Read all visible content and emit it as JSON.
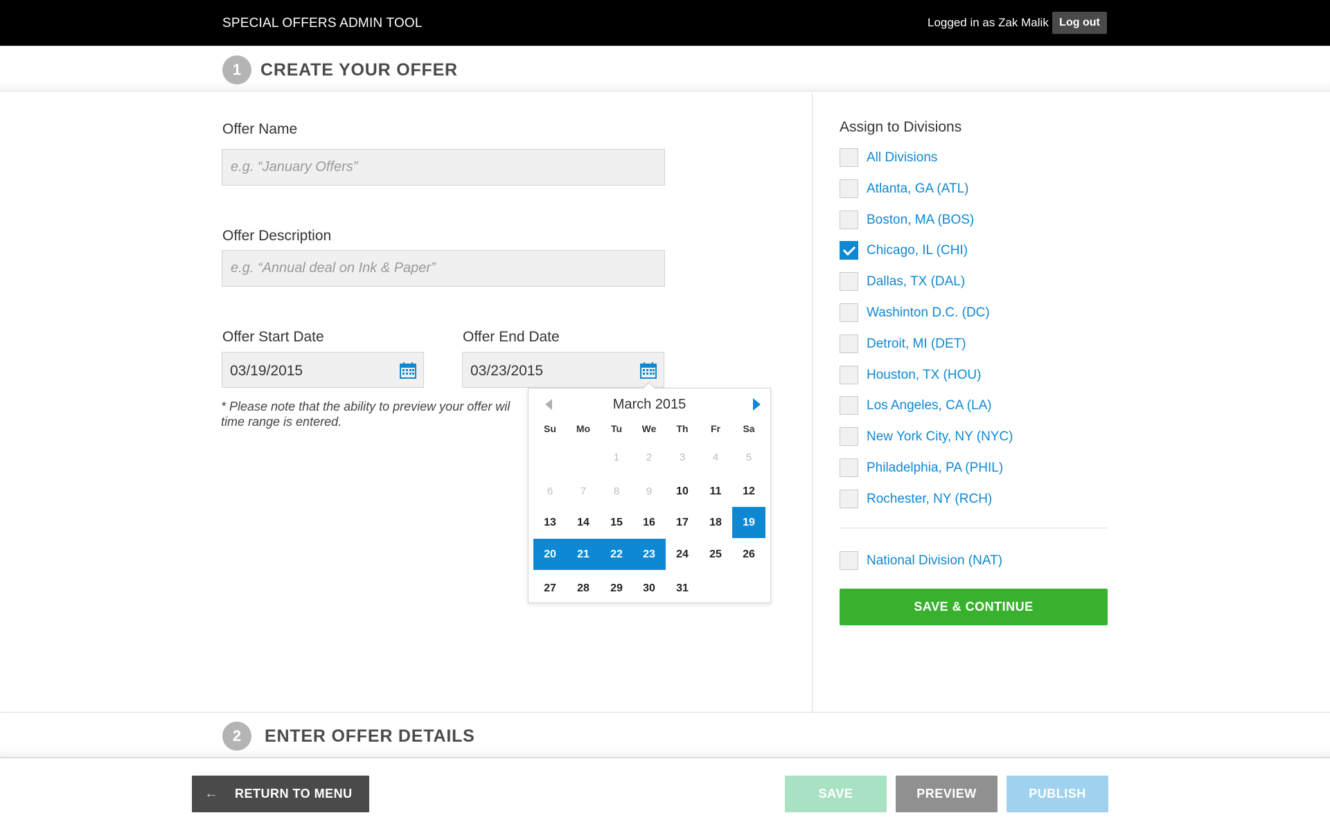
{
  "header": {
    "app_title": "SPECIAL OFFERS ADMIN TOOL",
    "login_text": "Logged in as Zak Malik",
    "logout_label": "Log out"
  },
  "steps": [
    {
      "number": "1",
      "title": "CREATE YOUR OFFER"
    },
    {
      "number": "2",
      "title": "ENTER OFFER DETAILS"
    }
  ],
  "form": {
    "offer_name_label": "Offer Name",
    "offer_name_placeholder": "e.g. “January Offers”",
    "offer_description_label": "Offer Description",
    "offer_description_placeholder": "e.g. “Annual deal on Ink & Paper”",
    "start_date_label": "Offer Start Date",
    "start_date_value": "03/19/2015",
    "end_date_label": "Offer End Date",
    "end_date_value": "03/23/2015",
    "note": "* Please note that the ability to preview your offer wil",
    "note_line2": "time range is entered."
  },
  "calendar": {
    "month_label": "March 2015",
    "weekdays": [
      "Su",
      "Mo",
      "Tu",
      "We",
      "Th",
      "Fr",
      "Sa"
    ],
    "weeks": [
      [
        {
          "d": ""
        },
        {
          "d": ""
        },
        {
          "d": "1",
          "m": true
        },
        {
          "d": "2",
          "m": true
        },
        {
          "d": "3",
          "m": true
        },
        {
          "d": "4",
          "m": true
        },
        {
          "d": "5",
          "m": true
        }
      ],
      [
        {
          "d": "6",
          "m": true
        },
        {
          "d": "7",
          "m": true
        },
        {
          "d": "8",
          "m": true
        },
        {
          "d": "9",
          "m": true
        },
        {
          "d": "10"
        },
        {
          "d": "11"
        },
        {
          "d": "12"
        }
      ],
      [
        {
          "d": "13"
        },
        {
          "d": "14"
        },
        {
          "d": "15"
        },
        {
          "d": "16"
        },
        {
          "d": "17"
        },
        {
          "d": "18"
        },
        {
          "d": "19",
          "s": true
        }
      ],
      [
        {
          "d": "20",
          "s": true
        },
        {
          "d": "21",
          "s": true
        },
        {
          "d": "22",
          "s": true
        },
        {
          "d": "23",
          "s": true
        },
        {
          "d": "24"
        },
        {
          "d": "25"
        },
        {
          "d": "26"
        }
      ],
      [
        {
          "d": "27"
        },
        {
          "d": "28"
        },
        {
          "d": "29"
        },
        {
          "d": "30"
        },
        {
          "d": "31"
        },
        {
          "d": ""
        },
        {
          "d": ""
        }
      ]
    ]
  },
  "divisions": {
    "title": "Assign to Divisions",
    "items": [
      {
        "label": "All Divisions",
        "checked": false
      },
      {
        "label": "Atlanta, GA (ATL)",
        "checked": false
      },
      {
        "label": "Boston, MA (BOS)",
        "checked": false
      },
      {
        "label": "Chicago, IL (CHI)",
        "checked": true
      },
      {
        "label": "Dallas, TX (DAL)",
        "checked": false
      },
      {
        "label": "Washinton D.C. (DC)",
        "checked": false
      },
      {
        "label": "Detroit, MI (DET)",
        "checked": false
      },
      {
        "label": "Houston, TX (HOU)",
        "checked": false
      },
      {
        "label": "Los Angeles, CA (LA)",
        "checked": false
      },
      {
        "label": "New York City, NY (NYC)",
        "checked": false
      },
      {
        "label": "Philadelphia, PA (PHIL)",
        "checked": false
      },
      {
        "label": "Rochester, NY (RCH)",
        "checked": false
      }
    ],
    "national": {
      "label": "National Division (NAT)",
      "checked": false
    },
    "save_continue_label": "SAVE & CONTINUE"
  },
  "footer": {
    "return_label": "RETURN TO MENU",
    "return_icon": "arrow-left-icon",
    "save_label": "SAVE",
    "preview_label": "PREVIEW",
    "publish_label": "PUBLISH"
  },
  "colors": {
    "accent_blue": "#0e88d3",
    "green": "#38b12e",
    "header_bg": "#000000"
  }
}
